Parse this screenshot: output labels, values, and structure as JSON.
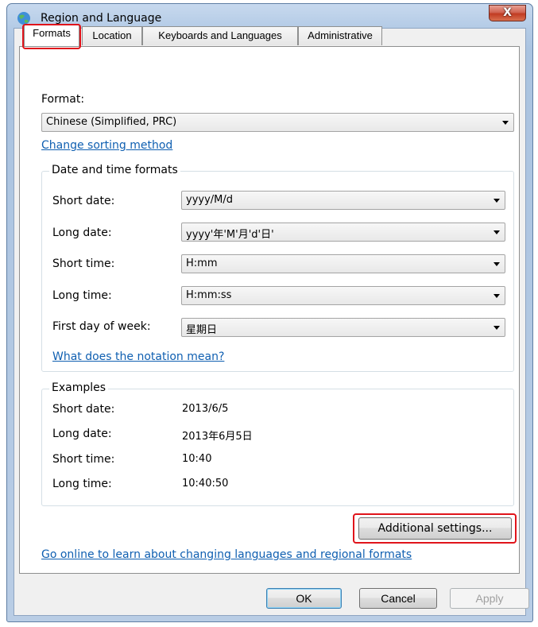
{
  "window": {
    "title": "Region and Language",
    "close_label": "X"
  },
  "tabs": [
    {
      "label": "Formats",
      "active": true
    },
    {
      "label": "Location",
      "active": false
    },
    {
      "label": "Keyboards and Languages",
      "active": false
    },
    {
      "label": "Administrative",
      "active": false
    }
  ],
  "formats": {
    "format_label": "Format:",
    "format_value": "Chinese (Simplified, PRC)",
    "sorting_link": "Change sorting method",
    "datetime_group": "Date and time formats",
    "fields": [
      {
        "label": "Short date:",
        "value": "yyyy/M/d"
      },
      {
        "label": "Long date:",
        "value": "yyyy'年'M'月'd'日'"
      },
      {
        "label": "Short time:",
        "value": "H:mm"
      },
      {
        "label": "Long time:",
        "value": "H:mm:ss"
      },
      {
        "label": "First day of week:",
        "value": "星期日"
      }
    ],
    "notation_link": "What does the notation mean?",
    "examples_group": "Examples",
    "examples": [
      {
        "label": "Short date:",
        "value": "2013/6/5"
      },
      {
        "label": "Long date:",
        "value": "2013年6月5日"
      },
      {
        "label": "Short time:",
        "value": "10:40"
      },
      {
        "label": "Long time:",
        "value": "10:40:50"
      }
    ],
    "additional_button": "Additional settings...",
    "online_link": "Go online to learn about changing languages and regional formats"
  },
  "buttons": {
    "ok": "OK",
    "cancel": "Cancel",
    "apply": "Apply"
  },
  "colors": {
    "highlight": "#e0141b",
    "link": "#0f5fb1"
  }
}
